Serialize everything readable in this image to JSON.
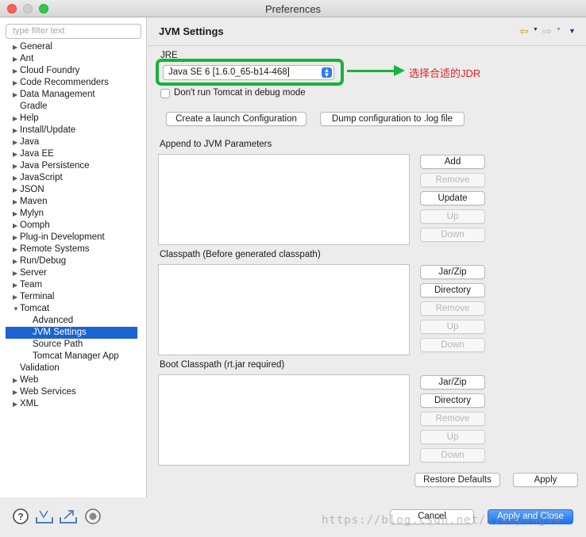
{
  "window": {
    "title": "Preferences"
  },
  "filter": {
    "placeholder": "type filter text"
  },
  "tree": [
    {
      "label": "General",
      "expandable": true
    },
    {
      "label": "Ant",
      "expandable": true
    },
    {
      "label": "Cloud Foundry",
      "expandable": true
    },
    {
      "label": "Code Recommenders",
      "expandable": true
    },
    {
      "label": "Data Management",
      "expandable": true
    },
    {
      "label": "Gradle",
      "expandable": false
    },
    {
      "label": "Help",
      "expandable": true
    },
    {
      "label": "Install/Update",
      "expandable": true
    },
    {
      "label": "Java",
      "expandable": true
    },
    {
      "label": "Java EE",
      "expandable": true
    },
    {
      "label": "Java Persistence",
      "expandable": true
    },
    {
      "label": "JavaScript",
      "expandable": true
    },
    {
      "label": "JSON",
      "expandable": true
    },
    {
      "label": "Maven",
      "expandable": true
    },
    {
      "label": "Mylyn",
      "expandable": true
    },
    {
      "label": "Oomph",
      "expandable": true
    },
    {
      "label": "Plug-in Development",
      "expandable": true
    },
    {
      "label": "Remote Systems",
      "expandable": true
    },
    {
      "label": "Run/Debug",
      "expandable": true
    },
    {
      "label": "Server",
      "expandable": true
    },
    {
      "label": "Team",
      "expandable": true
    },
    {
      "label": "Terminal",
      "expandable": true
    },
    {
      "label": "Tomcat",
      "expandable": true,
      "expanded": true
    },
    {
      "label": "Advanced",
      "child": true
    },
    {
      "label": "JVM Settings",
      "child": true,
      "selected": true
    },
    {
      "label": "Source Path",
      "child": true
    },
    {
      "label": "Tomcat Manager App",
      "child": true
    },
    {
      "label": "Validation",
      "expandable": false
    },
    {
      "label": "Web",
      "expandable": true
    },
    {
      "label": "Web Services",
      "expandable": true
    },
    {
      "label": "XML",
      "expandable": true
    }
  ],
  "page": {
    "title": "JVM Settings"
  },
  "jre": {
    "label": "JRE",
    "selected": "Java SE 6 [1.6.0_65-b14-468]",
    "annotation": "选择合适的JDR"
  },
  "debug_checkbox": {
    "label": "Don't run Tomcat in debug mode",
    "checked": false
  },
  "buttons": {
    "create_launch": "Create a launch Configuration",
    "dump_config": "Dump configuration to .log file",
    "restore_defaults": "Restore Defaults",
    "apply": "Apply",
    "cancel": "Cancel",
    "apply_close": "Apply and Close"
  },
  "jvm_params": {
    "label": "Append to JVM Parameters",
    "buttons": [
      "Add",
      "Remove",
      "Update",
      "Up",
      "Down"
    ]
  },
  "classpath": {
    "label": "Classpath (Before generated classpath)",
    "buttons": [
      "Jar/Zip",
      "Directory",
      "Remove",
      "Up",
      "Down"
    ]
  },
  "boot_classpath": {
    "label": "Boot Classpath (rt.jar required)",
    "buttons": [
      "Jar/Zip",
      "Directory",
      "Remove",
      "Up",
      "Down"
    ]
  },
  "watermark": "https://blog.csdn.net/xiaopeng90",
  "colors": {
    "selection": "#1b63d0",
    "highlight": "#18b33a",
    "annotation": "#e32020"
  }
}
